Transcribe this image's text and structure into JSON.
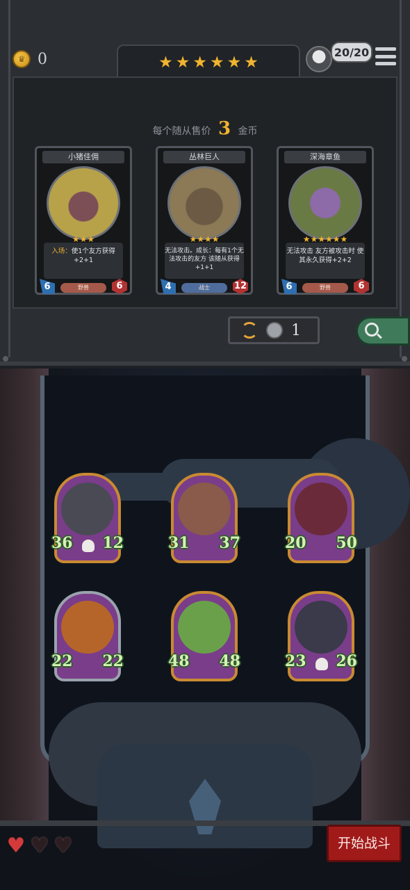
{
  "header": {
    "gold": "0",
    "tier_stars": 6,
    "capacity": "20/20"
  },
  "shop": {
    "sell_prefix": "每个随从售价",
    "sell_price": "3",
    "sell_suffix": "金币",
    "cards": [
      {
        "name": "小猪佳佣",
        "stars": 3,
        "text_keyword": "入场：",
        "text": "使1个友方获得+2+1",
        "attack": "6",
        "health": "6",
        "tribe": "野兽",
        "tribe_color": "#a5594a",
        "portrait_color": "#b7a24a"
      },
      {
        "name": "丛林巨人",
        "stars": 4,
        "text_keyword": "",
        "text": "无法攻击。成长：每有1个无法攻击的友方 该随从获得+1+1",
        "attack": "4",
        "health": "12",
        "tribe": "战士",
        "tribe_color": "#4f6d9c",
        "portrait_color": "#8b7a55"
      },
      {
        "name": "深海章鱼",
        "stars": 6,
        "text_keyword": "",
        "text": "无法攻击 友方被攻击时 使其永久获得+2+2",
        "attack": "6",
        "health": "6",
        "tribe": "野兽",
        "tribe_color": "#a5594a",
        "portrait_color": "#6a7a44"
      }
    ]
  },
  "refresh": {
    "cost": "1"
  },
  "board": {
    "minions": [
      {
        "attack": "36",
        "health": "12",
        "frame": "gold",
        "skull": true,
        "art": "#4a4a55"
      },
      {
        "attack": "31",
        "health": "37",
        "frame": "gold",
        "skull": false,
        "art": "#8a5a4a"
      },
      {
        "attack": "20",
        "health": "50",
        "frame": "gold",
        "skull": false,
        "art": "#6a2a3a"
      },
      {
        "attack": "22",
        "health": "22",
        "frame": "silver",
        "skull": false,
        "art": "#b6652a"
      },
      {
        "attack": "48",
        "health": "48",
        "frame": "gold",
        "skull": false,
        "art": "#6aa04a"
      },
      {
        "attack": "23",
        "health": "26",
        "frame": "gold",
        "skull": true,
        "art": "#3a3a4a"
      }
    ]
  },
  "lives": {
    "full": 1,
    "total": 3
  },
  "actions": {
    "start_battle": "开始战斗"
  }
}
